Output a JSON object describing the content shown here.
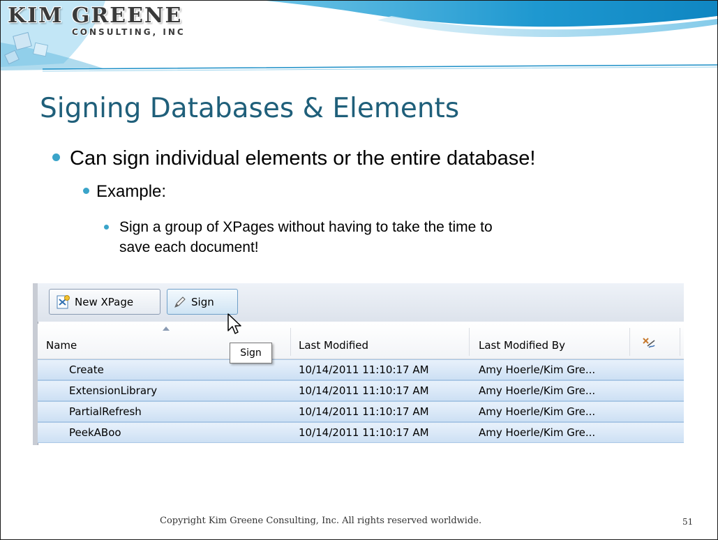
{
  "logo": {
    "line1": "KIM GREENE",
    "line2": "CONSULTING, INC"
  },
  "slide": {
    "title": "Signing Databases & Elements",
    "bullets": {
      "level1": "Can sign individual elements or the entire database!",
      "level2": "Example:",
      "level3": "Sign a group of XPages without having to take the time to save each document!"
    },
    "footer": "Copyright Kim Greene Consulting, Inc.  All rights reserved worldwide.",
    "page_number": "51"
  },
  "designer": {
    "toolbar": {
      "new_xpage": "New XPage",
      "sign": "Sign"
    },
    "tooltip": "Sign",
    "columns": {
      "name": "Name",
      "last_modified": "Last Modified",
      "last_modified_by": "Last Modified By"
    },
    "rows": [
      {
        "name": "Create",
        "modified": "10/14/2011 11:10:17 AM",
        "by": "Amy Hoerle/Kim Gre..."
      },
      {
        "name": "ExtensionLibrary",
        "modified": "10/14/2011 11:10:17 AM",
        "by": "Amy Hoerle/Kim Gre..."
      },
      {
        "name": "PartialRefresh",
        "modified": "10/14/2011 11:10:17 AM",
        "by": "Amy Hoerle/Kim Gre..."
      },
      {
        "name": "PeekABoo",
        "modified": "10/14/2011 11:10:17 AM",
        "by": "Amy Hoerle/Kim Gre..."
      }
    ]
  },
  "colors": {
    "title": "#1f5f7a",
    "bullet": "#3aa4c9",
    "selection": "#cde0f4"
  }
}
